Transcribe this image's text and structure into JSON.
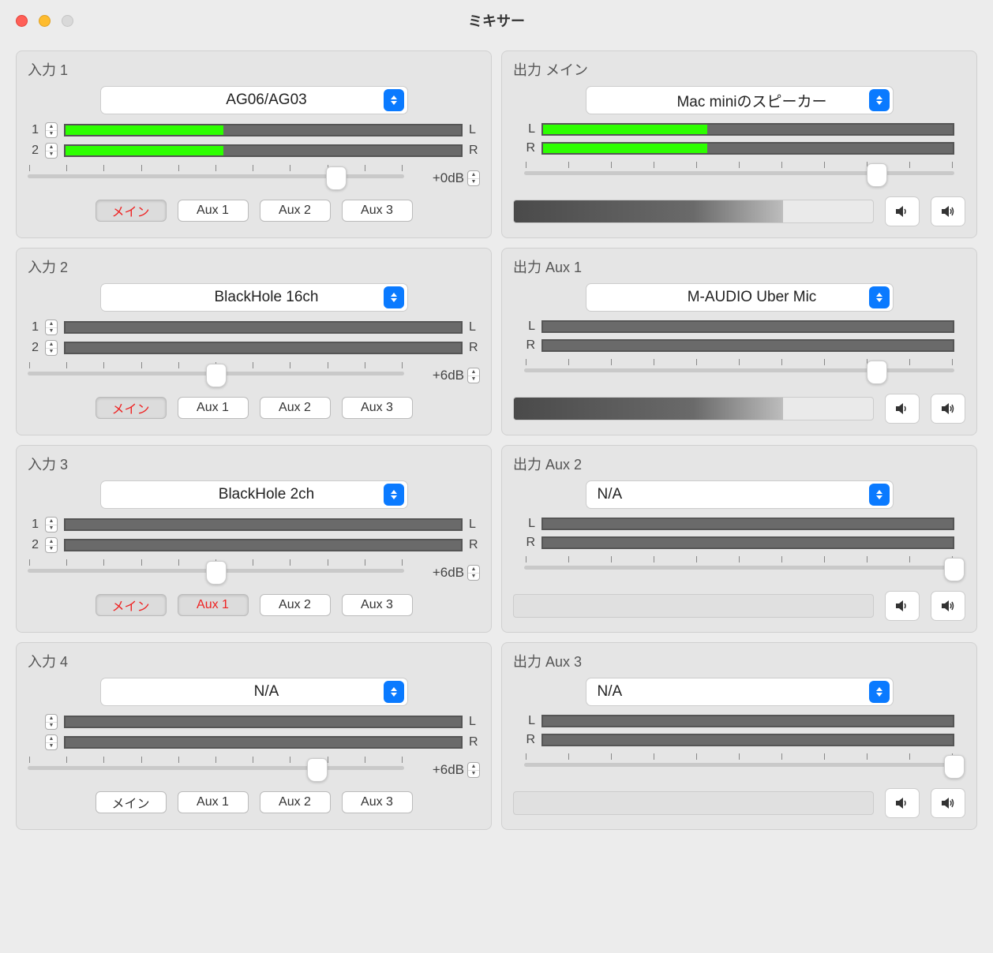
{
  "window": {
    "title": "ミキサー"
  },
  "inputs": [
    {
      "title": "入力 1",
      "device": "AG06/AG03",
      "channels": [
        {
          "num": "1",
          "label": "L",
          "level": 40
        },
        {
          "num": "2",
          "label": "R",
          "level": 40
        }
      ],
      "slider": 82,
      "db": "+0dB",
      "buttons": [
        {
          "label": "メイン",
          "active": true
        },
        {
          "label": "Aux 1",
          "active": false
        },
        {
          "label": "Aux 2",
          "active": false
        },
        {
          "label": "Aux 3",
          "active": false
        }
      ]
    },
    {
      "title": "入力 2",
      "device": "BlackHole 16ch",
      "channels": [
        {
          "num": "1",
          "label": "L",
          "level": 0
        },
        {
          "num": "2",
          "label": "R",
          "level": 0
        }
      ],
      "slider": 50,
      "db": "+6dB",
      "buttons": [
        {
          "label": "メイン",
          "active": true
        },
        {
          "label": "Aux 1",
          "active": false
        },
        {
          "label": "Aux 2",
          "active": false
        },
        {
          "label": "Aux 3",
          "active": false
        }
      ]
    },
    {
      "title": "入力 3",
      "device": "BlackHole 2ch",
      "channels": [
        {
          "num": "1",
          "label": "L",
          "level": 0
        },
        {
          "num": "2",
          "label": "R",
          "level": 0
        }
      ],
      "slider": 50,
      "db": "+6dB",
      "buttons": [
        {
          "label": "メイン",
          "active": true
        },
        {
          "label": "Aux 1",
          "active": true
        },
        {
          "label": "Aux 2",
          "active": false
        },
        {
          "label": "Aux 3",
          "active": false
        }
      ]
    },
    {
      "title": "入力 4",
      "device": "N/A",
      "channels": [
        {
          "num": "",
          "label": "L",
          "level": 0
        },
        {
          "num": "",
          "label": "R",
          "level": 0
        }
      ],
      "slider": 77,
      "db": "+6dB",
      "buttons": [
        {
          "label": "メイン",
          "active": false
        },
        {
          "label": "Aux 1",
          "active": false
        },
        {
          "label": "Aux 2",
          "active": false
        },
        {
          "label": "Aux 3",
          "active": false
        }
      ]
    }
  ],
  "outputs": [
    {
      "title": "出力 メイン",
      "device": "Mac miniのスピーカー",
      "channels": [
        {
          "label": "L",
          "level": 40
        },
        {
          "label": "R",
          "level": 40
        }
      ],
      "slider": 82,
      "bar": "grad"
    },
    {
      "title": "出力 Aux 1",
      "device": "M-AUDIO Uber Mic",
      "channels": [
        {
          "label": "L",
          "level": 0
        },
        {
          "label": "R",
          "level": 0
        }
      ],
      "slider": 82,
      "bar": "grad"
    },
    {
      "title": "出力 Aux 2",
      "device": "N/A",
      "channels": [
        {
          "label": "L",
          "level": 0
        },
        {
          "label": "R",
          "level": 0
        }
      ],
      "slider": 100,
      "bar": "empty"
    },
    {
      "title": "出力 Aux 3",
      "device": "N/A",
      "channels": [
        {
          "label": "L",
          "level": 0
        },
        {
          "label": "R",
          "level": 0
        }
      ],
      "slider": 100,
      "bar": "empty"
    }
  ]
}
